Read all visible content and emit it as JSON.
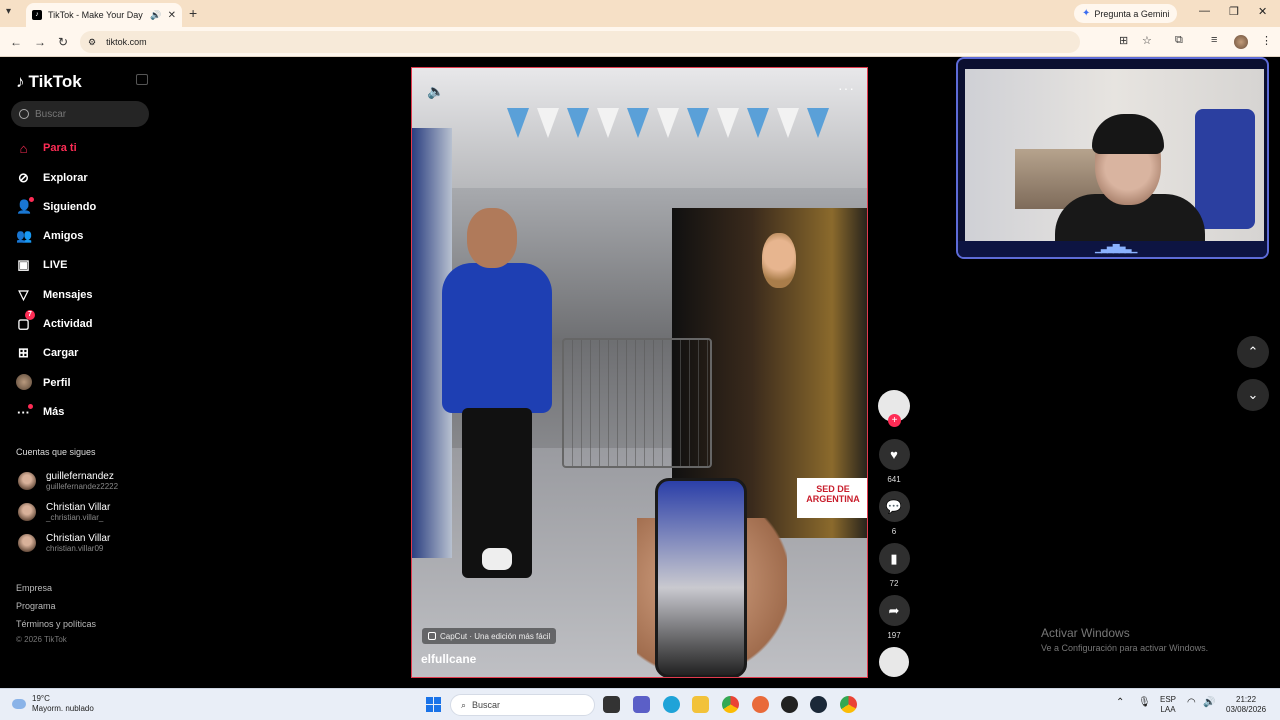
{
  "browser": {
    "tab_title": "TikTok - Make Your Day",
    "url": "tiktok.com",
    "gemini_label": "Pregunta a Gemini"
  },
  "sidebar": {
    "logo": "TikTok",
    "search_placeholder": "Buscar",
    "nav": [
      {
        "label": "Para ti",
        "icon": "home-icon"
      },
      {
        "label": "Explorar",
        "icon": "compass-icon"
      },
      {
        "label": "Siguiendo",
        "icon": "following-icon"
      },
      {
        "label": "Amigos",
        "icon": "friends-icon"
      },
      {
        "label": "LIVE",
        "icon": "live-icon"
      },
      {
        "label": "Mensajes",
        "icon": "messages-icon"
      },
      {
        "label": "Actividad",
        "icon": "activity-icon",
        "badge": "7"
      },
      {
        "label": "Cargar",
        "icon": "upload-icon"
      },
      {
        "label": "Perfil",
        "icon": "profile-avatar"
      },
      {
        "label": "Más",
        "icon": "more-icon"
      }
    ],
    "following_title": "Cuentas que sigues",
    "accounts": [
      {
        "name": "guillefernandez",
        "handle": "guillefernandez2222"
      },
      {
        "name": "Christian Villar",
        "handle": "_christian.villar_"
      },
      {
        "name": "Christian Villar",
        "handle": "christian.villar09"
      }
    ],
    "footer": [
      "Empresa",
      "Programa",
      "Términos y políticas"
    ],
    "copyright": "© 2026 TikTok"
  },
  "video": {
    "author": "elfullcane",
    "capcut_label": "CapCut · Una edición más fácil",
    "sign_text": "SED DE ARGENTINA"
  },
  "actions": {
    "likes": "641",
    "comments": "6",
    "saves": "72",
    "shares": "197"
  },
  "watermark": {
    "title": "Activar Windows",
    "subtitle": "Ve a Configuración para activar Windows."
  },
  "taskbar": {
    "temp": "19°C",
    "weather": "Mayorm. nublado",
    "search": "Buscar",
    "lang1": "ESP",
    "lang2": "LAA",
    "time": "21:22",
    "date": "03/08/2026"
  }
}
